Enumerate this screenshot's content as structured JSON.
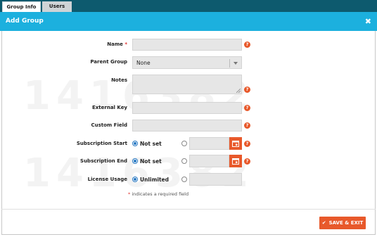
{
  "tabs": [
    {
      "label": "Group Info",
      "active": true
    },
    {
      "label": "Users",
      "active": false
    }
  ],
  "header": {
    "title": "Add Group",
    "close_icon": "close-icon"
  },
  "watermark": {
    "line1": "1416382",
    "line2": "1416382"
  },
  "form": {
    "name": {
      "label": "Name",
      "required_mark": "*",
      "value": ""
    },
    "parent_group": {
      "label": "Parent Group",
      "selected": "None"
    },
    "notes": {
      "label": "Notes",
      "value": ""
    },
    "external_key": {
      "label": "External Key",
      "value": ""
    },
    "custom_field": {
      "label": "Custom Field",
      "value": ""
    },
    "subscription_start": {
      "label": "Subscription Start",
      "option_not_set": "Not set",
      "selected": "not_set",
      "date_value": ""
    },
    "subscription_end": {
      "label": "Subscription End",
      "option_not_set": "Not set",
      "selected": "not_set",
      "date_value": ""
    },
    "license_usage": {
      "label": "License Usage",
      "option_unlimited": "Unlimited",
      "selected": "unlimited",
      "limit_value": ""
    },
    "help_glyph": "?",
    "required_note_star": "*",
    "required_note": " indicates a required field"
  },
  "footer": {
    "save_label": "SAVE & EXIT"
  },
  "colors": {
    "tabbar": "#0d5a6e",
    "header": "#1cb0de",
    "accent": "#e8592b",
    "radio": "#2a7ac4"
  }
}
